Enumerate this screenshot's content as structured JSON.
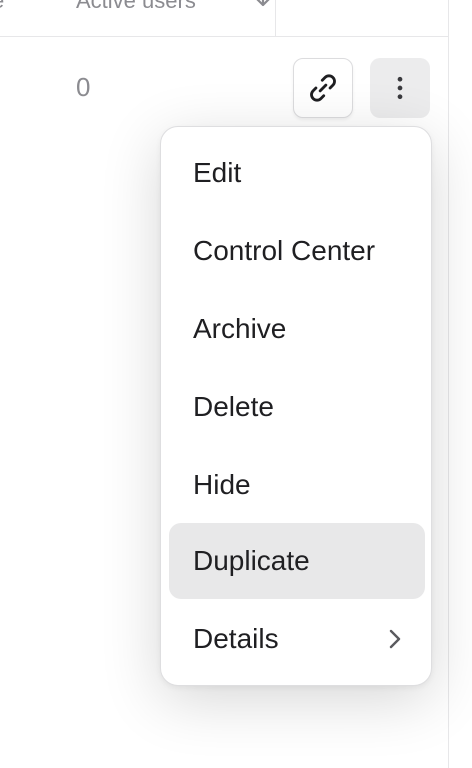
{
  "table": {
    "header_left": "e",
    "header_active_users": "Active users",
    "row_active_users": "0"
  },
  "icons": {
    "sort": "sort-arrow-icon",
    "link": "link-icon",
    "more": "more-vertical-icon",
    "submenu": "chevron-right-icon"
  },
  "menu": {
    "items": [
      {
        "label": "Edit"
      },
      {
        "label": "Control Center"
      },
      {
        "label": "Archive"
      },
      {
        "label": "Delete"
      },
      {
        "label": "Hide"
      },
      {
        "label": "Duplicate",
        "active": true
      },
      {
        "label": "Details",
        "has_submenu": true
      }
    ],
    "highlight_color": "#e8e8e9"
  }
}
